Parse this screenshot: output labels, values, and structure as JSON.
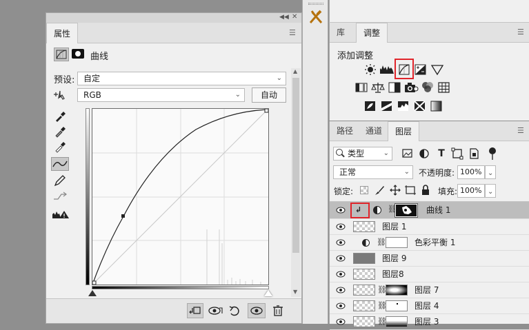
{
  "properties_panel": {
    "tab": "属性",
    "adjustment_name": "曲线",
    "preset_label": "预设:",
    "preset_value": "自定",
    "channel_value": "RGB",
    "auto_button": "自动"
  },
  "adjustments_panel": {
    "tabs": [
      "库",
      "调整"
    ],
    "heading": "添加调整"
  },
  "layers_panel": {
    "tabs": [
      "路径",
      "通道",
      "图层"
    ],
    "filter_kind": "类型",
    "blend_mode": "正常",
    "opacity_label": "不透明度:",
    "opacity_value": "100%",
    "lock_label": "锁定:",
    "fill_label": "填充:",
    "fill_value": "100%",
    "layers": [
      {
        "name": "曲线 1"
      },
      {
        "name": "图层 1"
      },
      {
        "name": "色彩平衡 1"
      },
      {
        "name": "图层 9"
      },
      {
        "name": "图层8"
      },
      {
        "name": "图层 7"
      },
      {
        "name": "图层 4"
      },
      {
        "name": "图层 3"
      }
    ]
  },
  "colors": {
    "highlight_red": "#e0242a",
    "panel_bg": "#f0f0f0",
    "selected_layer_bg": "#bdbdbd"
  }
}
